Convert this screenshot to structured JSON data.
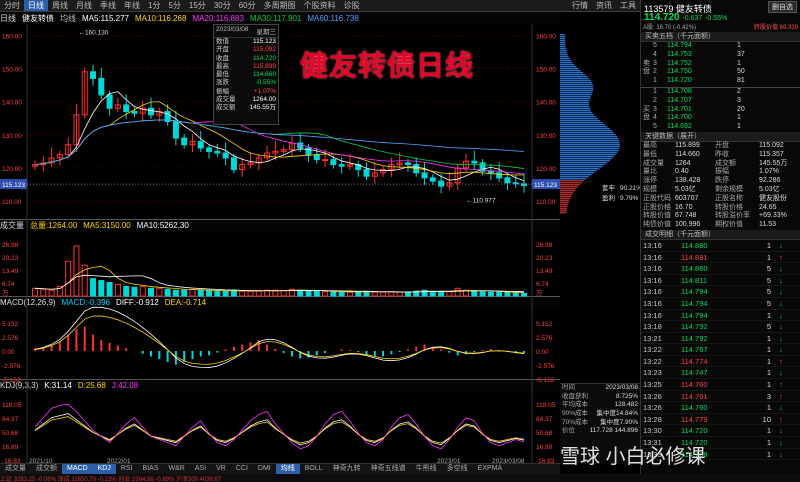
{
  "toolbar": {
    "tabs": [
      "分时",
      "日线",
      "周线",
      "月线",
      "季线",
      "年线",
      "1分",
      "5分",
      "15分",
      "30分",
      "60分",
      "多周期图",
      "个股资料",
      "诊股"
    ],
    "active": "日线",
    "right": [
      "行情",
      "资讯",
      "工具"
    ]
  },
  "title_overlay": "健友转债日线",
  "main_legend": {
    "label": "日线",
    "name": "健友转债",
    "items": [
      {
        "t": "均线",
        "c": "#bbbbbb"
      },
      {
        "t": "MA5:115.277",
        "c": "#ffffff"
      },
      {
        "t": "MA10:116.268",
        "c": "#ffd400"
      },
      {
        "t": "MA20:116.883",
        "c": "#ff33ff"
      },
      {
        "t": "MA30:117.901",
        "c": "#00cc44"
      },
      {
        "t": "MA60:116.738",
        "c": "#4fa0ff"
      }
    ]
  },
  "vol_legend": {
    "label": "成交量",
    "items": [
      {
        "t": "总量:1264.00",
        "c": "#ffd400"
      },
      {
        "t": "MA5:3150.00",
        "c": "#ffd400"
      },
      {
        "t": "MA10:5262.30",
        "c": "#ffffff"
      }
    ]
  },
  "macd_legend": {
    "label": "MACD",
    "params": "(12,26,9)",
    "items": [
      {
        "t": "MACD:-0.396",
        "c": "#00d0ff"
      },
      {
        "t": "DIFF:-0.912",
        "c": "#ffffff"
      },
      {
        "t": "DEA:-0.714",
        "c": "#ffd400"
      }
    ]
  },
  "kdj_legend": {
    "label": "KDJ",
    "params": "(9,3,3)",
    "items": [
      {
        "t": "K:31.14",
        "c": "#ffffff"
      },
      {
        "t": "D:25.68",
        "c": "#ffd400"
      },
      {
        "t": "J:42.08",
        "c": "#ff33ff"
      }
    ]
  },
  "infobox": {
    "date": "2023/03/08",
    "weekday": "星期三",
    "rows": [
      {
        "k": "数值",
        "v": "115.123",
        "c": "#ffffff"
      },
      {
        "k": "开盘",
        "v": "115.092",
        "c": "#ff4040"
      },
      {
        "k": "收盘",
        "v": "114.720",
        "c": "#00dd55"
      },
      {
        "k": "最高",
        "v": "115.899",
        "c": "#ff4040"
      },
      {
        "k": "最低",
        "v": "114.660",
        "c": "#00dd55"
      },
      {
        "k": "涨跌",
        "v": "-0.55%",
        "c": "#00dd55"
      },
      {
        "k": "振幅",
        "v": "+1.07%",
        "c": "#ff4040"
      },
      {
        "k": "成交量",
        "v": "1264.00",
        "c": "#ffffff"
      },
      {
        "k": "成交额",
        "v": "145.55万",
        "c": "#ffffff"
      }
    ]
  },
  "chart_data": [
    {
      "type": "line",
      "panel": "price",
      "ylim": [
        107,
        161
      ],
      "left_ticks": [
        "160.00",
        "150.00",
        "140.00",
        "130.00",
        "120.00",
        "110.00"
      ],
      "right_ticks": [
        "160.00",
        "150.00",
        "140.00",
        "130.00",
        "120.00",
        "110.00"
      ],
      "annotations": [
        "160.130",
        "110.977"
      ],
      "current": "115.123",
      "x_dates": [
        "2021/10",
        "2022/01",
        "2023/01",
        "2023/03/08"
      ],
      "close": [
        121,
        121.5,
        123,
        124,
        127,
        136,
        149,
        147,
        142,
        138,
        139,
        137,
        136.5,
        138,
        136,
        137,
        134,
        129,
        127,
        128,
        126,
        125,
        124.5,
        123,
        119.5,
        121,
        121.5,
        123,
        124.5,
        125,
        125.5,
        127.5,
        126,
        124,
        122.5,
        122.5,
        121,
        120.5,
        121,
        119.5,
        117.5,
        118.5,
        119.5,
        121,
        121.5,
        121,
        118.5,
        117,
        116,
        114.5,
        115.5,
        120,
        122,
        121.5,
        119,
        118.5,
        117,
        115.5,
        115.2,
        114.7
      ],
      "chip_stats": [
        {
          "k": "套牢",
          "v": "90.21%"
        },
        {
          "k": "盈利",
          "v": "9.79%"
        }
      ]
    },
    {
      "type": "bar",
      "panel": "volume",
      "left_ticks": [
        "26.98",
        "20.23",
        "13.49",
        "6.74"
      ],
      "right_ticks": [
        "26.98",
        "20.23",
        "13.49",
        "6.74"
      ],
      "unit": "万",
      "values": [
        4,
        3.5,
        3,
        5,
        18,
        26,
        16,
        9,
        8,
        7,
        6,
        5,
        4.5,
        5,
        4,
        4,
        3.5,
        3,
        3,
        3.5,
        3,
        2.8,
        2.5,
        2.5,
        3,
        2.5,
        2.5,
        2.5,
        3,
        3,
        2.8,
        3.5,
        3,
        2.5,
        2.5,
        2.2,
        2,
        2,
        2,
        2.2,
        2.5,
        2,
        2,
        2.2,
        2,
        2,
        2.5,
        3,
        2.5,
        2.5,
        2.2,
        4,
        3,
        2.5,
        2.2,
        2,
        2,
        1.8,
        1.5,
        1.3
      ]
    },
    {
      "type": "bar",
      "panel": "macd",
      "left_ticks": [
        "5.152",
        "2.576",
        "0.00",
        "-2.576",
        "-5.152"
      ],
      "right_ticks": [
        "5.152",
        "2.576",
        "0.00",
        "-2.576",
        "-5.152"
      ],
      "values": [
        0.5,
        0.7,
        1.1,
        1.8,
        3,
        4,
        4.5,
        3,
        2,
        1.5,
        1,
        0.5,
        0,
        -0.5,
        -1,
        -1.5,
        -2,
        -2.5,
        -2,
        -1.5,
        -1,
        -0.8,
        -0.3,
        0.3,
        0.8,
        1.2,
        1.6,
        2,
        1.2,
        0.4,
        -0.4,
        -1,
        -1.4,
        -1.2,
        -0.8,
        -0.4,
        0,
        0.3,
        0.2,
        -0.2,
        -0.6,
        -0.9,
        -1,
        -0.6,
        -0.2,
        0.3,
        0.8,
        1.2,
        0.8,
        0.3,
        -0.3,
        -0.8,
        -0.6,
        -0.2,
        0.2,
        0.4,
        0.1,
        -0.2,
        -0.4,
        -0.4
      ]
    },
    {
      "type": "line",
      "panel": "kdj",
      "left_ticks": [
        "118.05",
        "84.37",
        "50.68",
        "16.89",
        "-16.83"
      ],
      "right_ticks": [
        "118.05",
        "84.37",
        "50.68",
        "16.89",
        "-16.83"
      ],
      "k": [
        55,
        70,
        85,
        90,
        95,
        80,
        65,
        50,
        40,
        30,
        45,
        60,
        70,
        55,
        40,
        35,
        30,
        25,
        40,
        55,
        65,
        45,
        30,
        25,
        35,
        50,
        65,
        75,
        80,
        60,
        45,
        30,
        20,
        25,
        40,
        60,
        75,
        80,
        65,
        45,
        30,
        25,
        35,
        55,
        70,
        75,
        60,
        40,
        25,
        20,
        35,
        55,
        70,
        65,
        45,
        30,
        25,
        30,
        35,
        31.14
      ]
    }
  ],
  "vol_labels": {
    "bottom_left": "万",
    "bottom_right": "万"
  },
  "bottom_tabs": [
    "成交量",
    "成交额",
    "MACD",
    "KDJ",
    "RSI",
    "BIAS",
    "W&R",
    "ASI",
    "VR",
    "CCI",
    "DMI",
    "均线",
    "BOLL",
    "神奇九转",
    "神奇五线谱",
    "牛熊线",
    "多空线",
    "EXPMA"
  ],
  "bottom_active": [
    "MACD",
    "KDJ",
    "均线"
  ],
  "right_panel": {
    "code": "113579",
    "name": "健友转债",
    "price": "114.720",
    "change": "-0.637",
    "pct": "-0.55%",
    "sub_left": "A股: 16.70 (-0.42%)",
    "sub_right": "转股价值 69.339",
    "button": "删自选",
    "orderbook_title": "买卖五档（千元面额）",
    "asks": [
      {
        "l": "5",
        "p": "114.794",
        "v": "1"
      },
      {
        "l": "4",
        "p": "114.753",
        "v": "37"
      },
      {
        "l": "3",
        "p": "114.752",
        "v": "1"
      },
      {
        "l": "2",
        "p": "114.750",
        "v": "50"
      },
      {
        "l": "1",
        "p": "114.720",
        "v": "81"
      }
    ],
    "bids": [
      {
        "l": "1",
        "p": "114.708",
        "v": "2"
      },
      {
        "l": "2",
        "p": "114.707",
        "v": "3"
      },
      {
        "l": "3",
        "p": "114.701",
        "v": "20"
      },
      {
        "l": "4",
        "p": "114.700",
        "v": "1"
      },
      {
        "l": "5",
        "p": "114.692",
        "v": "1"
      }
    ],
    "ask_tag": "卖盘",
    "bid_tag": "买盘",
    "info_title": "关键数据（展开）",
    "info": [
      {
        "a": "最高",
        "av": "115.899",
        "b": "开盘",
        "bv": "115.092"
      },
      {
        "a": "最低",
        "av": "114.660",
        "b": "昨收",
        "bv": "115.357"
      },
      {
        "a": "成交量",
        "av": "1264",
        "b": "成交额",
        "bv": "145.55万"
      },
      {
        "a": "量比",
        "av": "0.40",
        "b": "振幅",
        "bv": "1.07%"
      },
      {
        "a": "涨停",
        "av": "138.428",
        "b": "跌停",
        "bv": "92.286"
      },
      {
        "a": "规模",
        "av": "5.03亿",
        "b": "剩余规模",
        "bv": "5.03亿"
      },
      {
        "a": "正股代码",
        "av": "603707",
        "b": "正股名称",
        "bv": "健友股份"
      },
      {
        "a": "正股价格",
        "av": "16.70",
        "b": "转股价格",
        "bv": "24.65"
      },
      {
        "a": "转股价值",
        "av": "67.748",
        "b": "转股溢价率",
        "bv": "+69.33%"
      },
      {
        "a": "纯债价值",
        "av": "100.996",
        "b": "期权价值",
        "bv": "11.53"
      }
    ],
    "ticks_title": "成交明细（千元面额）",
    "ticks": [
      {
        "t": "13:16",
        "p": "114.880",
        "v": "1",
        "d": "↓"
      },
      {
        "t": "13:16",
        "p": "114.881",
        "v": "1",
        "d": "↑"
      },
      {
        "t": "13:16",
        "p": "114.860",
        "v": "5",
        "d": "↓"
      },
      {
        "t": "13:16",
        "p": "114.811",
        "v": "5",
        "d": "↓"
      },
      {
        "t": "13:16",
        "p": "114.794",
        "v": "5",
        "d": "↓"
      },
      {
        "t": "13:16",
        "p": "114.794",
        "v": "5",
        "d": "↓"
      },
      {
        "t": "13:16",
        "p": "114.794",
        "v": "1",
        "d": "↓"
      },
      {
        "t": "13:18",
        "p": "114.792",
        "v": "5",
        "d": "↓"
      },
      {
        "t": "13:21",
        "p": "114.792",
        "v": "1",
        "d": "↓"
      },
      {
        "t": "13:22",
        "p": "114.767",
        "v": "1",
        "d": "↓"
      },
      {
        "t": "13:22",
        "p": "114.774",
        "v": "1",
        "d": "↑"
      },
      {
        "t": "13:23",
        "p": "114.747",
        "v": "1",
        "d": "↓"
      },
      {
        "t": "13:25",
        "p": "114.760",
        "v": "1",
        "d": "↑"
      },
      {
        "t": "13:26",
        "p": "114.761",
        "v": "3",
        "d": "↑"
      },
      {
        "t": "13:26",
        "p": "114.760",
        "v": "1",
        "d": "↓"
      },
      {
        "t": "13:28",
        "p": "114.779",
        "v": "10",
        "d": "↑"
      },
      {
        "t": "13:30",
        "p": "114.720",
        "v": "1",
        "d": "↓"
      },
      {
        "t": "13:31",
        "p": "114.720",
        "v": "1",
        "d": "↓"
      },
      {
        "t": "13:33",
        "p": "114.708",
        "v": "1",
        "d": "↓"
      }
    ]
  },
  "cost_box": {
    "rows": [
      {
        "k": "时间",
        "v": "2023/03/08"
      },
      {
        "k": "收盘获利",
        "v": "8.725%"
      },
      {
        "k": "平均成本",
        "v": "128.482"
      },
      {
        "k": "90%成本",
        "v": "集中度14.84%"
      },
      {
        "k": "70%成本",
        "v": "集中度7.90%"
      },
      {
        "k": "价位",
        "v": "117.728   144.896"
      }
    ]
  },
  "watermark": "雪球  小白必修课",
  "statusbar": "上证 3283.25  -0.06%  深成 11650.70  -0.23%  创业 2364.56  -0.89%  沪深300 4039.67"
}
